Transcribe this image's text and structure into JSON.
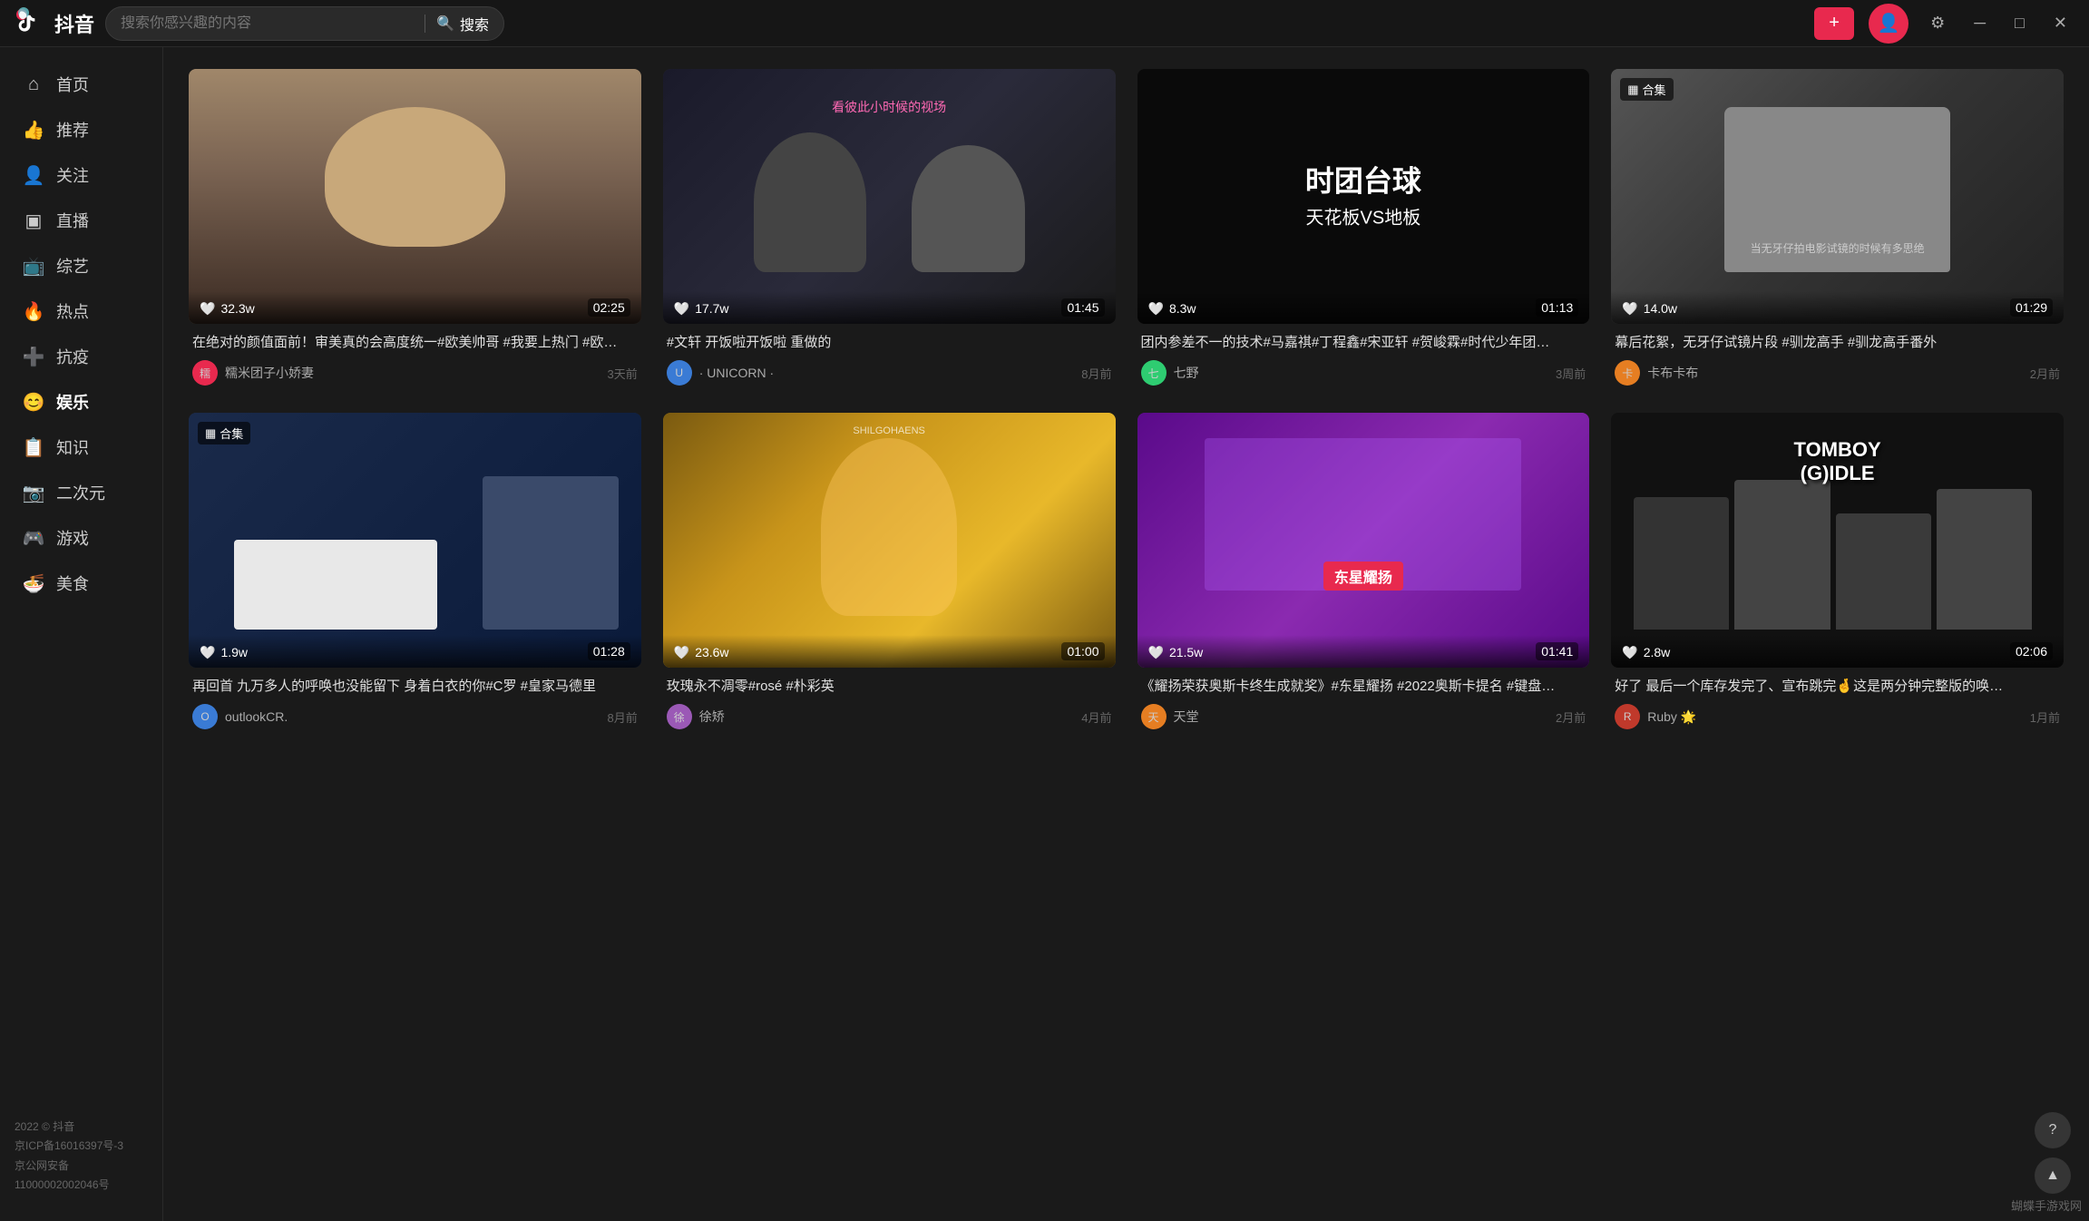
{
  "app": {
    "name": "抖音",
    "logo_text": "抖音"
  },
  "titlebar": {
    "search_placeholder": "搜索你感兴趣的内容",
    "search_btn": "搜索",
    "upload_icon": "+",
    "settings_icon": "⚙",
    "minimize_icon": "─",
    "maximize_icon": "□",
    "close_icon": "✕"
  },
  "sidebar": {
    "items": [
      {
        "id": "home",
        "label": "首页",
        "icon": "⌂"
      },
      {
        "id": "recommend",
        "label": "推荐",
        "icon": "👍"
      },
      {
        "id": "follow",
        "label": "关注",
        "icon": "👤"
      },
      {
        "id": "live",
        "label": "直播",
        "icon": "▣"
      },
      {
        "id": "variety",
        "label": "综艺",
        "icon": "📺"
      },
      {
        "id": "hot",
        "label": "热点",
        "icon": "🔥"
      },
      {
        "id": "anti",
        "label": "抗疫",
        "icon": "+"
      },
      {
        "id": "entertainment",
        "label": "娱乐",
        "icon": "😊"
      },
      {
        "id": "knowledge",
        "label": "知识",
        "icon": "📋"
      },
      {
        "id": "anime",
        "label": "二次元",
        "icon": "📷"
      },
      {
        "id": "game",
        "label": "游戏",
        "icon": "🎮"
      },
      {
        "id": "food",
        "label": "美食",
        "icon": "🍜"
      }
    ],
    "footer": {
      "copyright": "2022 © 抖音",
      "icp": "京ICP备16016397号-3",
      "security": "京公网安备",
      "code": "11000002002046号"
    }
  },
  "videos": [
    {
      "id": 1,
      "title": "在绝对的颜值面前！审美真的会高度统一#欧美帅哥 #我要上热门 #欧…",
      "likes": "32.3w",
      "duration": "02:25",
      "author": "糯米团子小娇妻",
      "time": "3天前",
      "thumb_type": "person",
      "has_collection": false
    },
    {
      "id": 2,
      "title": "#文轩 开饭啦开饭啦 重做的",
      "likes": "17.7w",
      "duration": "01:45",
      "author": "· UNICORN ·",
      "time": "8月前",
      "thumb_type": "people",
      "has_collection": false
    },
    {
      "id": 3,
      "title": "团内参差不一的技术#马嘉祺#丁程鑫#宋亚轩 #贺峻霖#时代少年团…",
      "likes": "8.3w",
      "duration": "01:13",
      "author": "七野",
      "time": "3周前",
      "thumb_type": "text",
      "thumb_text": "时团台球",
      "thumb_subtext": "天花板VS地板",
      "has_collection": false
    },
    {
      "id": 4,
      "title": "幕后花絮，无牙仔试镜片段 #驯龙高手 #驯龙高手番外",
      "likes": "14.0w",
      "duration": "01:29",
      "author": "卡布卡布",
      "time": "2月前",
      "thumb_caption": "当无牙仔拍电影试镜的时候有多思绝",
      "thumb_type": "person_gray",
      "has_collection": true
    },
    {
      "id": 5,
      "title": "再回首 九万多人的呼唤也没能留下 身着白衣的你#C罗 #皇家马德里",
      "likes": "1.9w",
      "duration": "01:28",
      "author": "outlookCR.",
      "time": "8月前",
      "thumb_type": "outdoor",
      "has_collection": true
    },
    {
      "id": 6,
      "title": "玫瑰永不凋零#rosé #朴彩英",
      "likes": "23.6w",
      "duration": "01:00",
      "author": "徐矫",
      "time": "4月前",
      "thumb_type": "gold",
      "has_collection": false
    },
    {
      "id": 7,
      "title": "《耀扬荣获奥斯卡终生成就奖》#东星耀扬 #2022奥斯卡提名 #键盘…",
      "likes": "21.5w",
      "duration": "01:41",
      "author": "天堂",
      "time": "2月前",
      "thumb_type": "purple",
      "thumb_badge": "东星耀扬",
      "has_collection": false
    },
    {
      "id": 8,
      "title": "好了 最后一个库存发完了、宣布跳完🤞这是两分钟完整版的唤…",
      "likes": "2.8w",
      "duration": "02:06",
      "author": "Ruby",
      "author_suffix": "🌟",
      "time": "1月前",
      "thumb_type": "tomboy",
      "thumb_text": "TOMBOY\n(G)IDLE",
      "has_collection": false
    }
  ],
  "bottom_bar": {
    "label": "蝴蝶手游戏网"
  },
  "help_icon": "?",
  "scroll_up_icon": "▲"
}
